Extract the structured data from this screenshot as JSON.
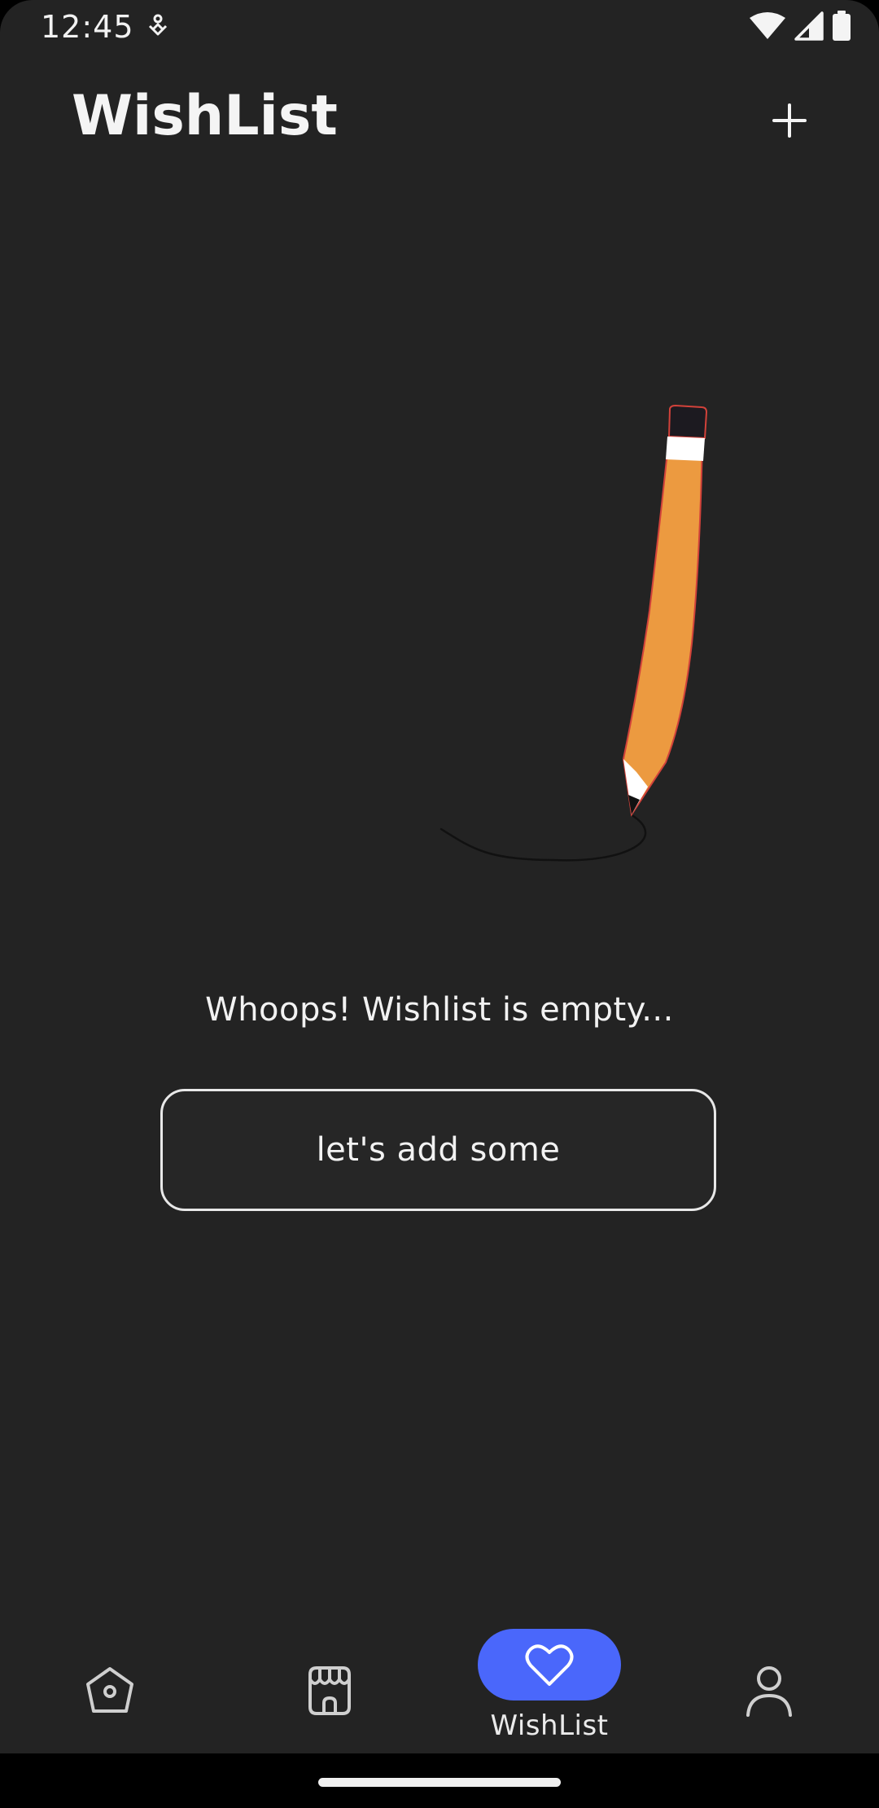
{
  "status_bar": {
    "time": "12:45",
    "icons": [
      "notification-icon",
      "wifi-icon",
      "cellular-signal-icon",
      "battery-icon"
    ]
  },
  "app_bar": {
    "title": "WishList",
    "action_icon": "plus-icon"
  },
  "empty_state": {
    "illustration": "pencil-drawing-illustration",
    "message": "Whoops! Wishlist is empty...",
    "button_label": "let's add some"
  },
  "bottom_nav": {
    "items": [
      {
        "icon": "home-icon",
        "label": "",
        "selected": false
      },
      {
        "icon": "store-icon",
        "label": "",
        "selected": false
      },
      {
        "icon": "heart-icon",
        "label": "WishList",
        "selected": true
      },
      {
        "icon": "profile-icon",
        "label": "",
        "selected": false
      }
    ]
  },
  "colors": {
    "background": "#232323",
    "accent": "#4a67fb",
    "pencil_body": "#ec9a40",
    "text": "#f2f2f2"
  }
}
